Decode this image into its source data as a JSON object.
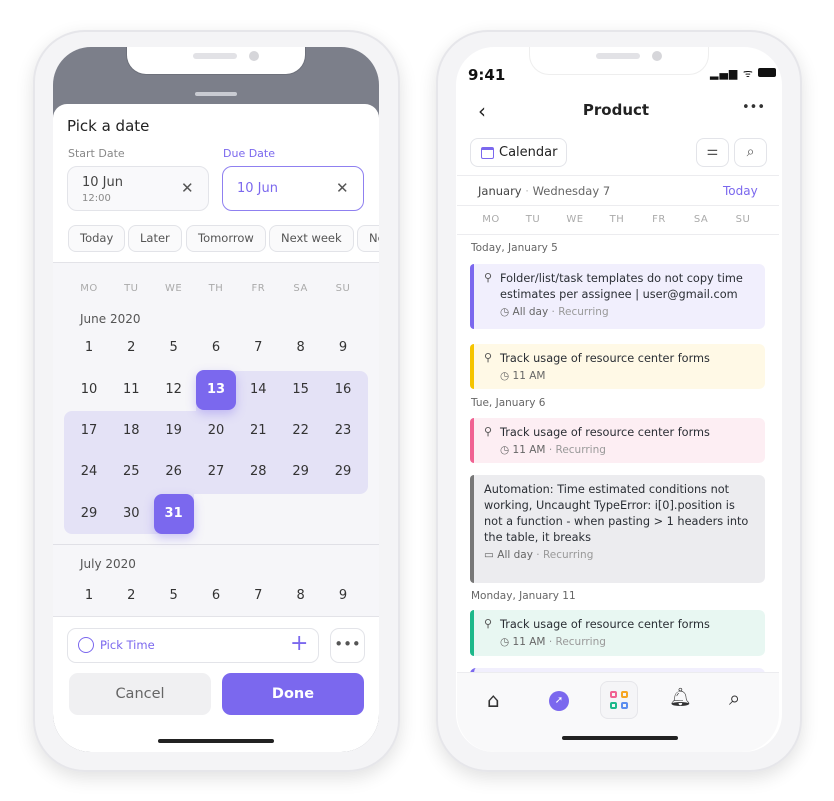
{
  "picker": {
    "title": "Pick a date",
    "start_label": "Start Date",
    "start_date": "10 Jun",
    "start_time": "12:00",
    "due_label": "Due Date",
    "due_date": "10 Jun",
    "quick": [
      "Today",
      "Later",
      "Tomorrow",
      "Next week",
      "Next"
    ],
    "weekdays": [
      "MO",
      "TU",
      "WE",
      "TH",
      "FR",
      "SA",
      "SU"
    ],
    "month1": "June 2020",
    "weeks": [
      [
        "1",
        "2",
        "5",
        "6",
        "7",
        "8",
        "9"
      ],
      [
        "10",
        "11",
        "12",
        "13",
        "14",
        "15",
        "16"
      ],
      [
        "17",
        "18",
        "19",
        "20",
        "21",
        "22",
        "23"
      ],
      [
        "24",
        "25",
        "26",
        "27",
        "28",
        "29",
        "29"
      ],
      [
        "29",
        "30",
        "31"
      ]
    ],
    "selected": [
      "13",
      "31"
    ],
    "month2": "July 2020",
    "month2_week": [
      "1",
      "2",
      "5",
      "6",
      "7",
      "8",
      "9"
    ],
    "pick_time": "Pick Time",
    "cancel": "Cancel",
    "done": "Done",
    "accent": "#7b68ee",
    "range_color": "#e4e2f6"
  },
  "app": {
    "time": "9:41",
    "title": "Product",
    "view": "Calendar",
    "month": "January",
    "day": "Wednesday 7",
    "today": "Today",
    "weekdays": [
      "MO",
      "TU",
      "WE",
      "TH",
      "FR",
      "SA",
      "SU"
    ],
    "sections": [
      "Today, January 5",
      "Tue, January 6",
      "Monday, January 11"
    ],
    "events": [
      {
        "title": "Folder/list/task templates do not copy time estimates per assignee | user@gmail.com",
        "time": "All day",
        "recur": "Recurring",
        "color": "#7b68ee",
        "bg": "#f1effd"
      },
      {
        "title": "Track usage of resource center forms",
        "time": "11 AM",
        "recur": "",
        "color": "#f5c400",
        "bg": "#fff9e6"
      },
      {
        "title": "Track usage of resource center forms",
        "time": "11 AM",
        "recur": "Recurring",
        "color": "#f06292",
        "bg": "#fdeef3"
      },
      {
        "title": "Automation: Time estimated conditions not working, Uncaught TypeError: i[0].position is not a function - when pasting > 1 headers into the table, it breaks",
        "time": "All day",
        "recur": "Recurring",
        "color": "#777",
        "bg": "#ececef"
      },
      {
        "title": "Track usage of resource center forms",
        "time": "11 AM",
        "recur": "Recurring",
        "color": "#1db88a",
        "bg": "#e8f7f2"
      }
    ],
    "nav": [
      "home-icon",
      "compass-icon",
      "apps-icon",
      "bell-icon",
      "search-icon"
    ]
  }
}
